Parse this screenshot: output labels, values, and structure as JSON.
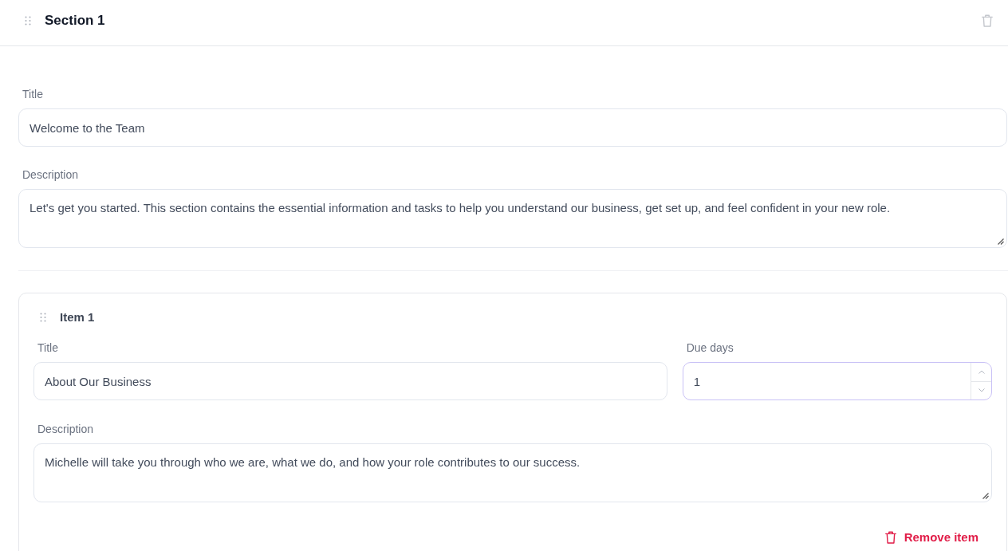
{
  "section": {
    "title": "Section 1"
  },
  "fields": [
    {
      "kind": "text",
      "label": "Title",
      "value": "Welcome to the Team",
      "focused": false
    },
    {
      "kind": "textarea",
      "label": "Description",
      "value": "Let's get you started. This section contains the essential information and tasks to help you understand our business, get set up, and feel confident in your new role.",
      "focused": false
    }
  ],
  "items": [
    {
      "title": "Item 1",
      "fields": [
        {
          "kind": "text",
          "label": "Title",
          "value": "About Our Business",
          "focused": false
        },
        {
          "kind": "number",
          "label": "Due days",
          "value": "1",
          "focused": true
        },
        {
          "kind": "textarea",
          "label": "Description",
          "value": "Michelle will take you through who we are, what we do, and how your role contributes to our success.",
          "focused": false
        }
      ],
      "remove_label": "Remove item"
    }
  ]
}
